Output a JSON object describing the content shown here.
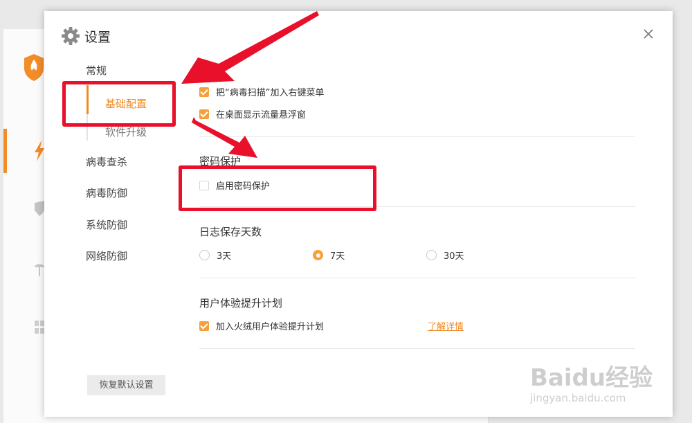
{
  "dialog": {
    "title": "设置",
    "close_icon": "close-icon",
    "settings_icon": "gear-icon"
  },
  "nav": {
    "group_general": "常规",
    "sub_basic": "基础配置",
    "sub_upgrade": "软件升级",
    "virus_scan": "病毒查杀",
    "virus_defense": "病毒防御",
    "system_defense": "系统防御",
    "network_defense": "网络防御",
    "active": "基础配置"
  },
  "sections": {
    "section1": {
      "options": [
        {
          "label": "把“病毒扫描”加入右键菜单",
          "checked": true
        },
        {
          "label": "在桌面显示流量悬浮窗",
          "checked": true
        }
      ]
    },
    "password": {
      "title": "密码保护",
      "enable_label": "启用密码保护",
      "enable_checked": false
    },
    "log": {
      "title": "日志保存天数",
      "options": [
        "3天",
        "7天",
        "30天"
      ],
      "selected": "7天"
    },
    "ux": {
      "title": "用户体验提升计划",
      "join_label": "加入火绒用户体验提升计划",
      "join_checked": true,
      "details_link": "了解详情"
    }
  },
  "footer": {
    "restore_defaults": "恢复默认设置"
  },
  "watermark": {
    "main": "Baidu经验",
    "sub": "jingyan.baidu.com"
  },
  "colors": {
    "accent": "#f08a24",
    "checkbox": "#f5a03c",
    "annotation": "#e8102a"
  }
}
